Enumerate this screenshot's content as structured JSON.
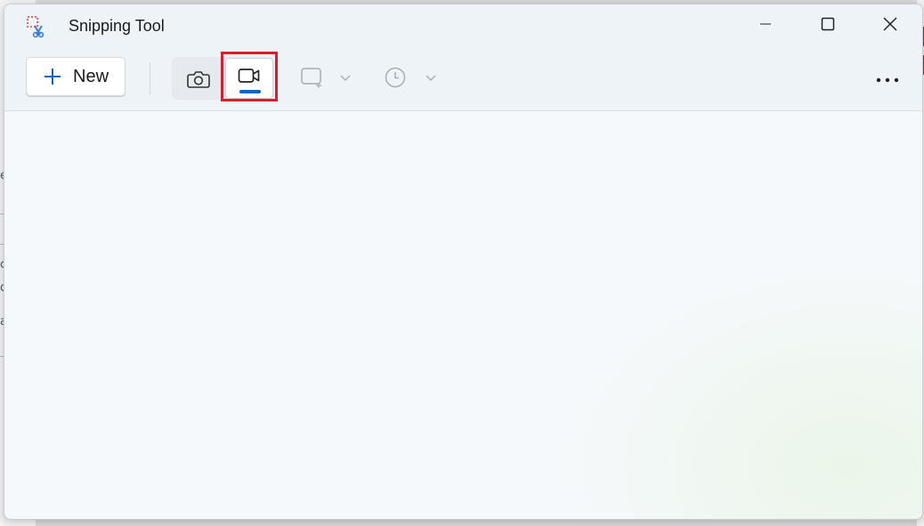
{
  "window": {
    "title": "Snipping Tool"
  },
  "toolbar": {
    "new_label": "New",
    "icons": {
      "app": "snipping-tool-icon",
      "new": "plus-icon",
      "photo_mode": "camera-icon",
      "video_mode": "video-camera-icon",
      "shape": "rectangle-snip-icon",
      "delay": "clock-icon",
      "more": "ellipsis-icon"
    },
    "selected_mode": "video"
  },
  "background_fragments": [
    "e",
    "c",
    "d",
    "a"
  ],
  "colors": {
    "accent": "#0a63c5",
    "highlight_box": "#e21b2a",
    "window_bg": "#f6f9fc"
  }
}
